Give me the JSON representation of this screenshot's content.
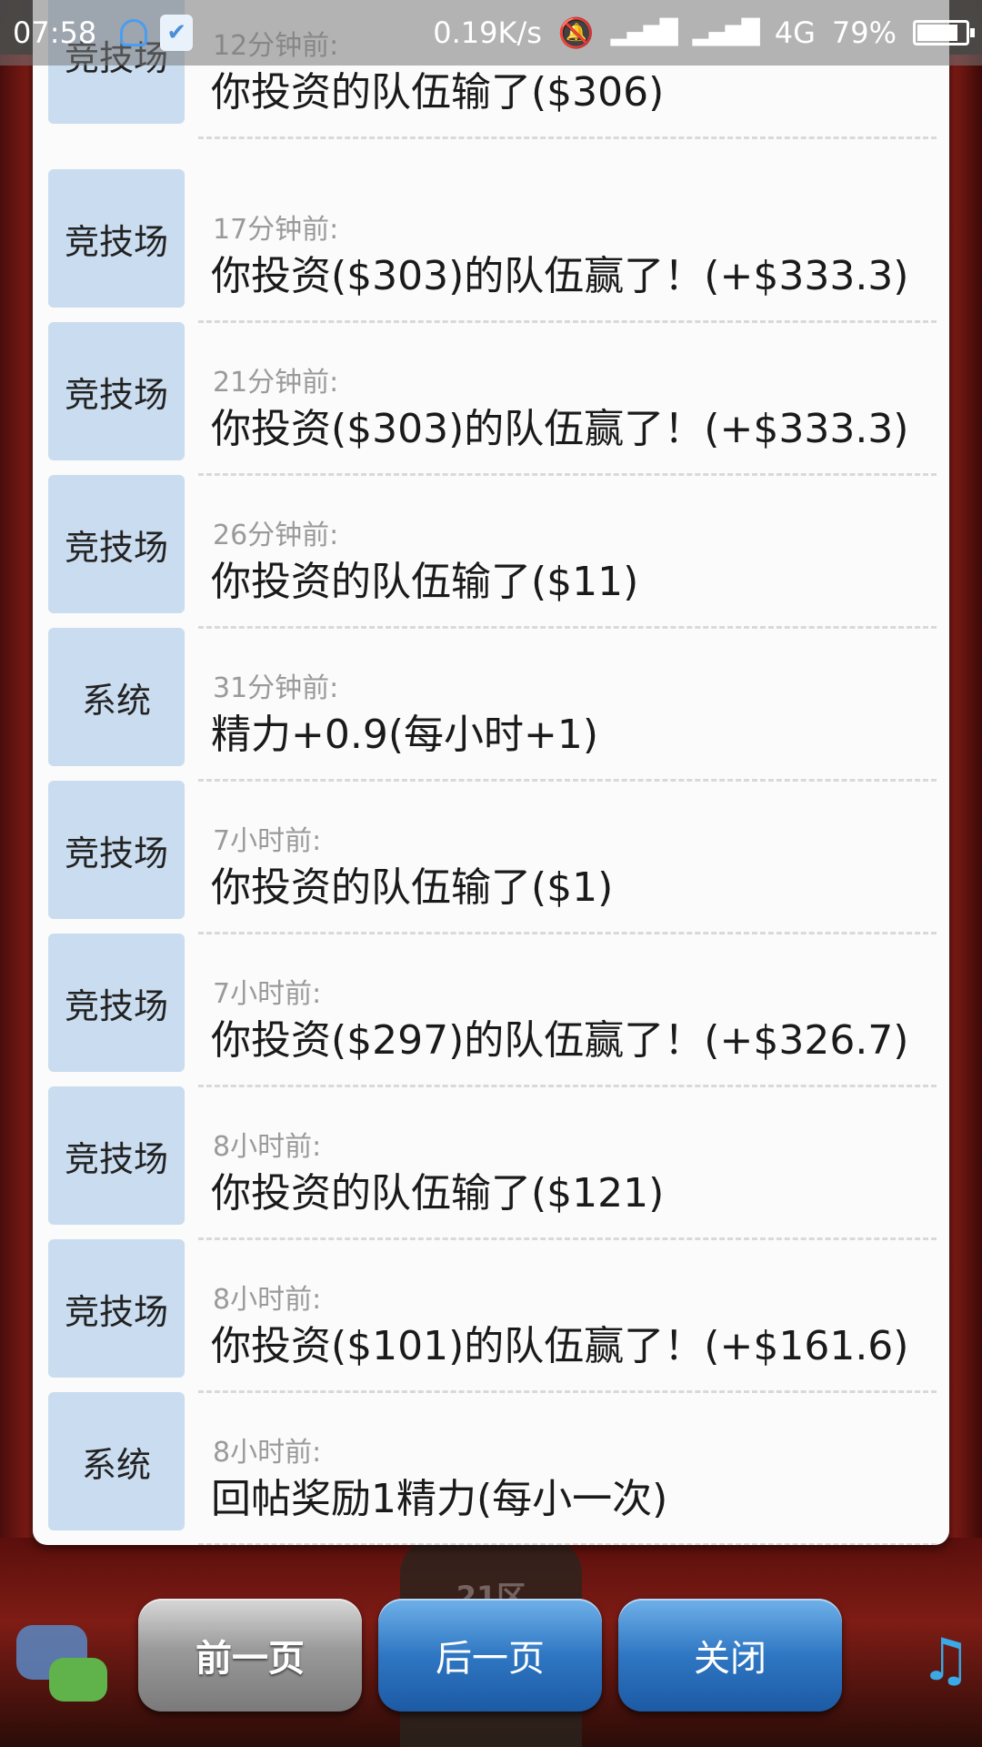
{
  "status_bar": {
    "time": "07:58",
    "net_speed": "0.19K/s",
    "network": "4G",
    "battery": "79%",
    "battery_level": 0.79
  },
  "messages": [
    {
      "tag": "竞技场",
      "time": "12分钟前:",
      "text": "你投资的队伍输了($306)"
    },
    {
      "tag": "竞技场",
      "time": "17分钟前:",
      "text": "你投资($303)的队伍赢了！(+$333.3)"
    },
    {
      "tag": "竞技场",
      "time": "21分钟前:",
      "text": "你投资($303)的队伍赢了！(+$333.3)"
    },
    {
      "tag": "竞技场",
      "time": "26分钟前:",
      "text": "你投资的队伍输了($11)"
    },
    {
      "tag": "系统",
      "time": "31分钟前:",
      "text": "精力+0.9(每小时+1)"
    },
    {
      "tag": "竞技场",
      "time": "7小时前:",
      "text": "你投资的队伍输了($1)"
    },
    {
      "tag": "竞技场",
      "time": "7小时前:",
      "text": "你投资($297)的队伍赢了！(+$326.7)"
    },
    {
      "tag": "竞技场",
      "time": "8小时前:",
      "text": "你投资的队伍输了($121)"
    },
    {
      "tag": "竞技场",
      "time": "8小时前:",
      "text": "你投资($101)的队伍赢了！(+$161.6)"
    },
    {
      "tag": "系统",
      "time": "8小时前:",
      "text": "回帖奖励1精力(每小一次)"
    }
  ],
  "buttons": {
    "prev": "前一页",
    "next": "后一页",
    "close": "关闭"
  },
  "background": {
    "door_label": "21区"
  },
  "colors": {
    "tag_bg": "#cadcef",
    "button_blue": "#2f77c3",
    "button_gray": "#9a9a9a"
  }
}
